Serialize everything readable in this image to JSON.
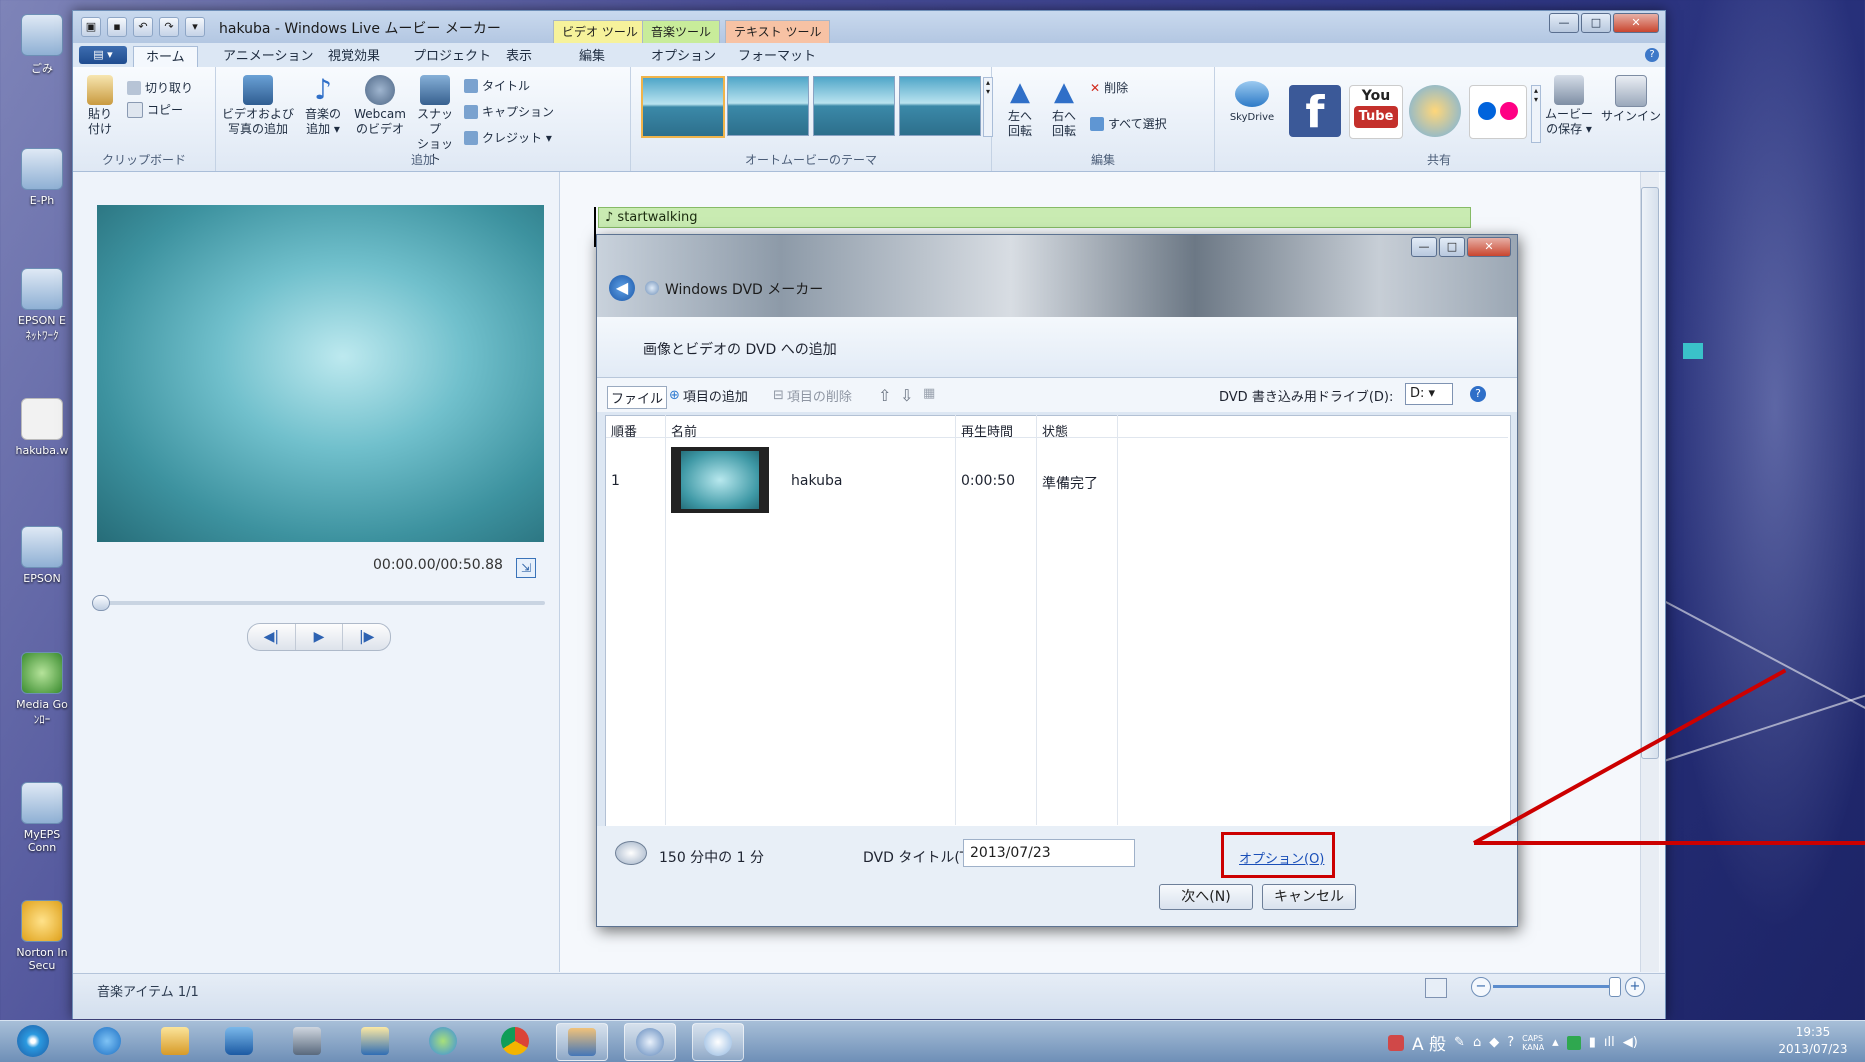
{
  "desktop": {
    "icons": [
      {
        "label": "ごみ"
      },
      {
        "label": "E-Ph"
      },
      {
        "label": "EPSON E"
      },
      {
        "label": "ﾈｯﾄﾜｰｸ"
      },
      {
        "label": "hakuba.w"
      },
      {
        "label": "EPSON"
      },
      {
        "label": "Media Go"
      },
      {
        "label": "ﾝﾛｰ"
      },
      {
        "label": "MyEPS"
      },
      {
        "label": "Conn"
      },
      {
        "label": "Norton In"
      },
      {
        "label": "Secu"
      }
    ]
  },
  "window": {
    "title": "hakuba - Windows Live ムービー メーカー",
    "context_tabs": [
      {
        "label": "ビデオ ツール",
        "color": "#f6f29b"
      },
      {
        "label": "音楽ツール",
        "color": "#c8ec9a"
      },
      {
        "label": "テキスト ツール",
        "color": "#f7c2a4"
      }
    ],
    "ribbon_tabs": [
      "ホーム",
      "アニメーション",
      "視覚効果",
      "プロジェクト",
      "表示",
      "編集",
      "オプション",
      "フォーマット"
    ],
    "ribbon": {
      "clipboard": {
        "paste": "貼り\n付け",
        "cut": "切り取り",
        "copy": "コピー",
        "label": "クリップボード"
      },
      "add": {
        "add_video": "ビデオおよび\n写真の追加",
        "add_music": "音楽の\n追加 ▾",
        "webcam": "Webcam\nのビデオ",
        "snapshot": "スナップ\nショット",
        "title": "タイトル",
        "caption": "キャプション",
        "credit": "クレジット ▾",
        "label": "追加"
      },
      "themes": {
        "label": "オートムービーのテーマ"
      },
      "edit": {
        "rotate_left": "左へ\n回転",
        "rotate_right": "右へ\n回転",
        "delete": "削除",
        "select_all": "すべて選択",
        "label": "編集"
      },
      "share": {
        "skydrive": "SkyDrive",
        "save_movie": "ムービー\nの保存 ▾",
        "sign_in": "サインイン",
        "label": "共有"
      }
    },
    "preview": {
      "time": "00:00.00/00:50.88"
    },
    "storyboard": {
      "music_track": "♪ startwalking"
    },
    "status": {
      "text": "音楽アイテム 1/1"
    }
  },
  "dvd_dialog": {
    "title": "Windows DVD メーカー",
    "heading": "画像とビデオの DVD への追加",
    "toolbar": {
      "file": "ファイル",
      "add_items": "項目の追加",
      "remove_items": "項目の削除",
      "drive_label": "DVD 書き込み用ドライブ(D):",
      "drive_value": "D:"
    },
    "columns": [
      "順番",
      "名前",
      "再生時間",
      "状態"
    ],
    "rows": [
      {
        "order": "1",
        "name": "hakuba",
        "duration": "0:00:50",
        "status": "準備完了"
      }
    ],
    "footer": {
      "capacity": "150 分中の 1 分",
      "title_label": "DVD タイトル(T):",
      "title_value": "2013/07/23",
      "options_link": "オプション(O)",
      "next_button": "次へ(N)",
      "cancel_button": "キャンセル"
    },
    "highlight_color": "#cc0000"
  },
  "taskbar": {
    "clock_time": "19:35",
    "clock_date": "2013/07/23",
    "ime": "A 般"
  }
}
